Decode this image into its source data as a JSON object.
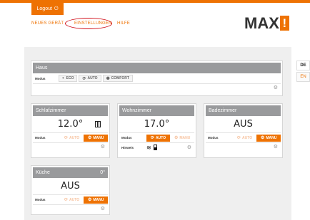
{
  "header": {
    "logout_label": "Logout",
    "logout_icon": "power-icon",
    "nav": [
      "NEUES GERÄT",
      "EINSTELLUNGEN",
      "HILFE"
    ],
    "highlighted_nav": "EINSTELLUNGEN",
    "logo_text": "MAX",
    "logo_mark": "!"
  },
  "languages": [
    "DE",
    "EN"
  ],
  "colors": {
    "accent": "#ee7203",
    "card_header": "#999a9c",
    "highlight": "#d1101a"
  },
  "haus": {
    "title": "Haus",
    "modus_label": "Modus",
    "buttons": [
      "ECO",
      "AUTO",
      "COMFORT"
    ]
  },
  "rooms": [
    {
      "name": "Schlafzimmer",
      "value": "12.0°",
      "modus_label": "Modus",
      "auto": "AUTO",
      "manu": "MANU",
      "active": "MANU",
      "indicator": "window-open-icon"
    },
    {
      "name": "Wohnzimmer",
      "value": "17.0°",
      "modus_label": "Modus",
      "auto": "AUTO",
      "manu": "MANU",
      "active": "AUTO",
      "hinweis_label": "Hinweis"
    },
    {
      "name": "Badezimmer",
      "value": "AUS",
      "modus_label": "Modus",
      "auto": "AUTO",
      "manu": "MANU",
      "active": "MANU"
    },
    {
      "name": "Küche",
      "header_value": "0°",
      "value": "AUS",
      "modus_label": "Modus",
      "auto": "AUTO",
      "manu": "MANU",
      "active": "MANU"
    }
  ]
}
